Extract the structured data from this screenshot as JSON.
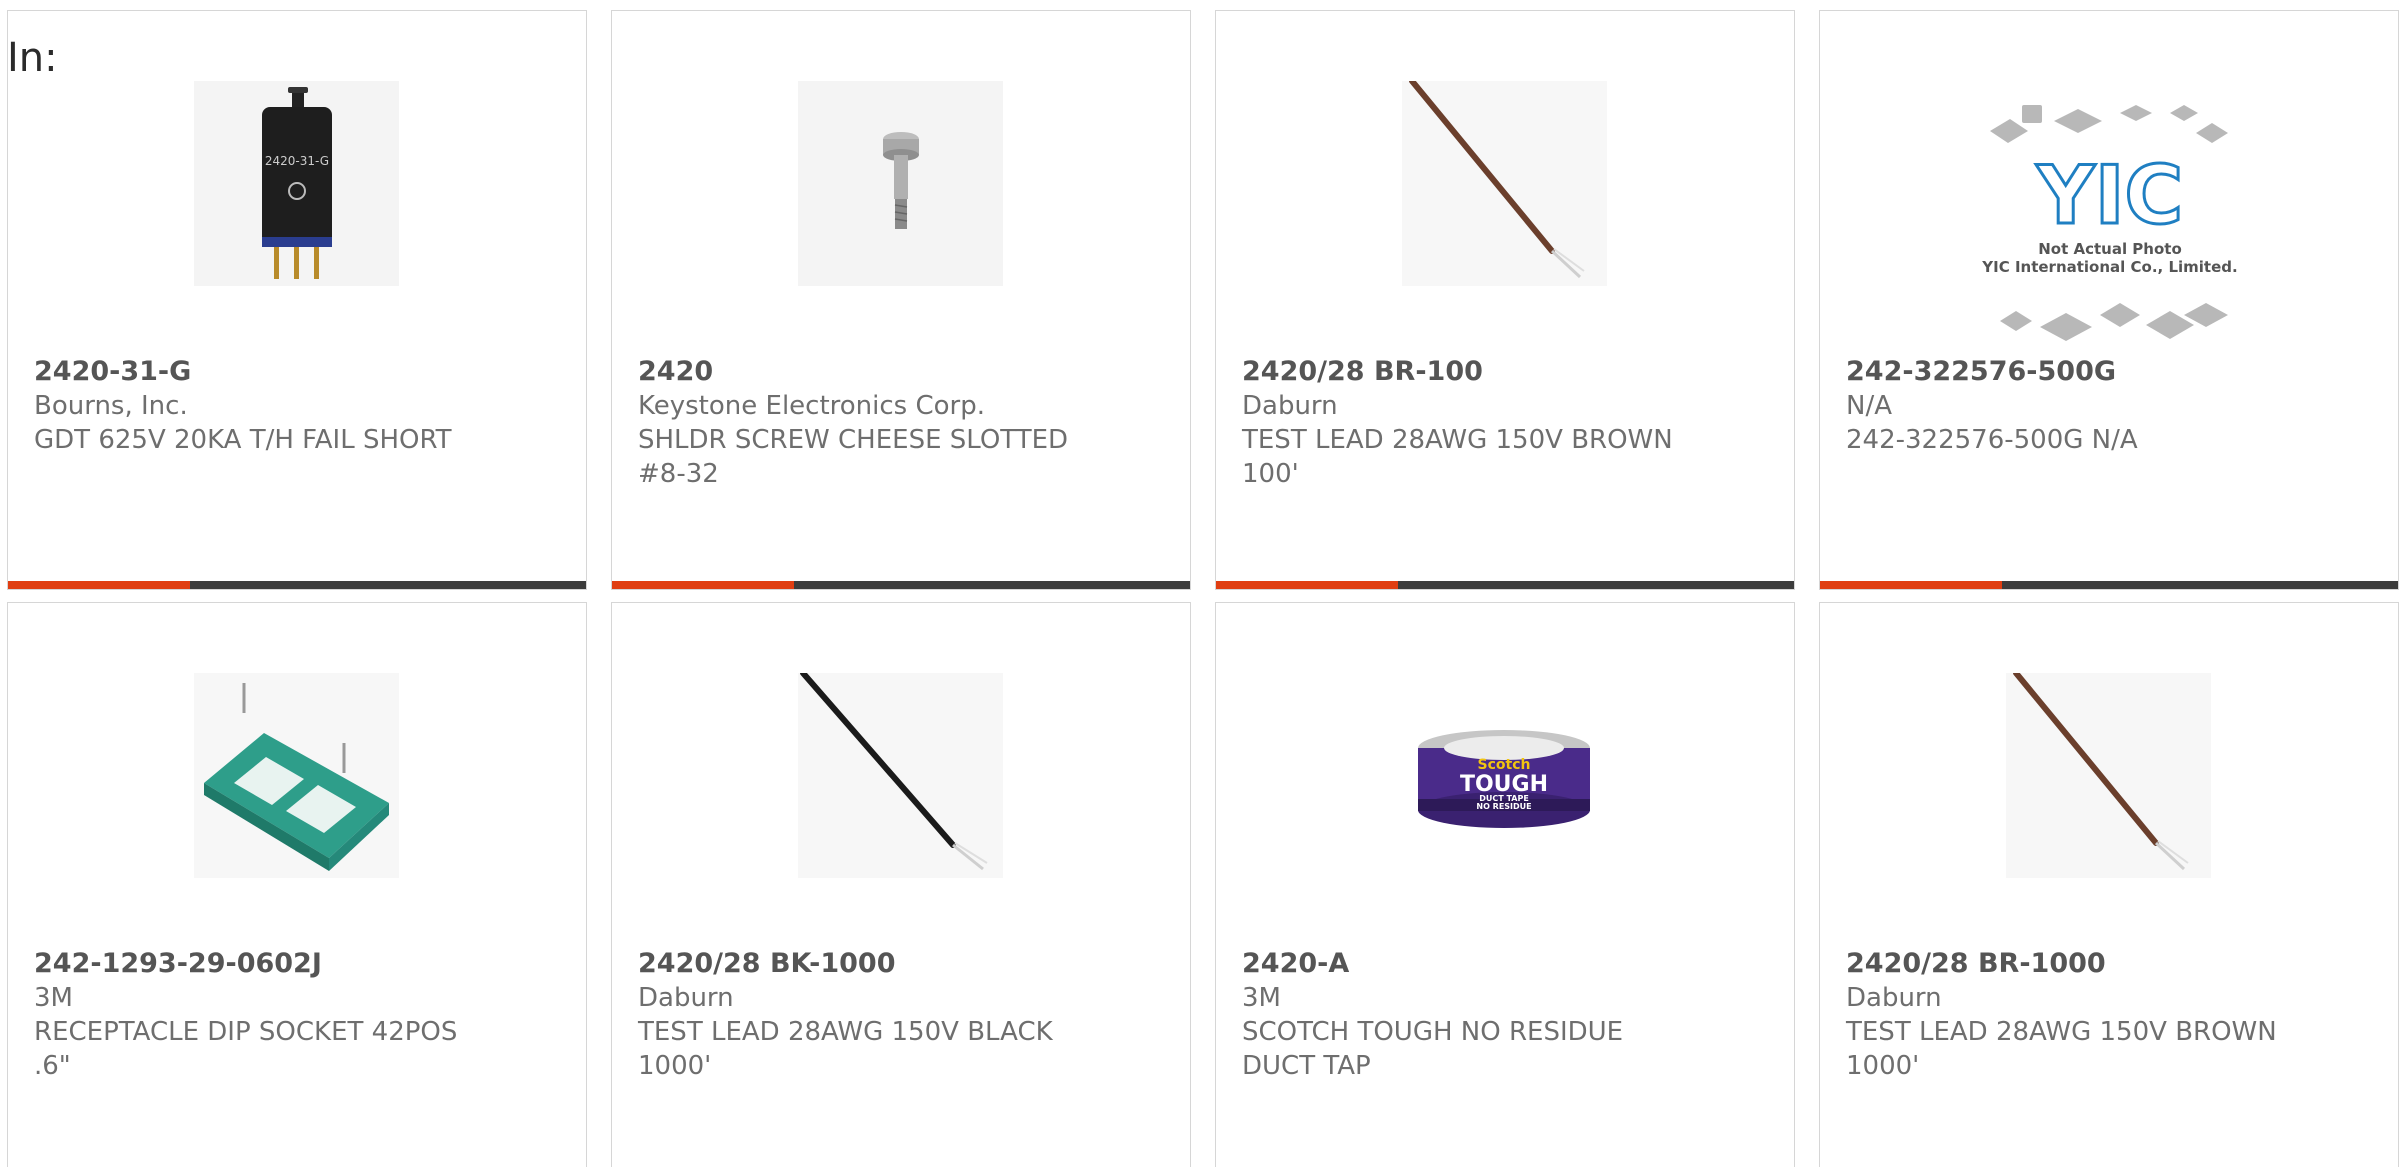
{
  "header": {
    "in_label": "In:"
  },
  "products": [
    {
      "part_number": "2420-31-G",
      "manufacturer": "Bourns, Inc.",
      "description": "GDT 625V 20KA T/H FAIL SHORT",
      "image_icon": "gas-discharge-tube-icon"
    },
    {
      "part_number": "2420",
      "manufacturer": "Keystone Electronics Corp.",
      "description": "SHLDR SCREW CHEESE SLOTTED #8-32",
      "image_icon": "shoulder-screw-icon"
    },
    {
      "part_number": "2420/28 BR-100",
      "manufacturer": "Daburn",
      "description": "TEST LEAD 28AWG 150V BROWN 100'",
      "image_icon": "brown-wire-icon"
    },
    {
      "part_number": "242-322576-500G",
      "manufacturer": "N/A",
      "description": "242-322576-500G N/A",
      "image_icon": "placeholder-logo-icon",
      "placeholder": {
        "logo_text": "YIC",
        "line1": "Not Actual Photo",
        "line2": "YIC International Co., Limited."
      }
    },
    {
      "part_number": "242-1293-29-0602J",
      "manufacturer": "3M",
      "description": "RECEPTACLE DIP SOCKET 42POS .6\"",
      "image_icon": "dip-socket-icon"
    },
    {
      "part_number": "2420/28 BK-1000",
      "manufacturer": "Daburn",
      "description": "TEST LEAD 28AWG 150V BLACK 1000'",
      "image_icon": "black-wire-icon"
    },
    {
      "part_number": "2420-A",
      "manufacturer": "3M",
      "description": "SCOTCH TOUGH NO RESIDUE DUCT TAP",
      "image_icon": "duct-tape-roll-icon",
      "label": {
        "brand": "Scotch",
        "name": "TOUGH",
        "sub": "DUCT TAPE",
        "band": "NO RESIDUE"
      }
    },
    {
      "part_number": "2420/28 BR-1000",
      "manufacturer": "Daburn",
      "description": "TEST LEAD 28AWG 150V BROWN 1000'",
      "image_icon": "brown-wire-icon"
    }
  ],
  "colors": {
    "accent": "#e03e12",
    "bar": "#3c3c3c",
    "border": "#d6d6d6",
    "text_bold": "#555555",
    "text": "#6e6e6e"
  }
}
